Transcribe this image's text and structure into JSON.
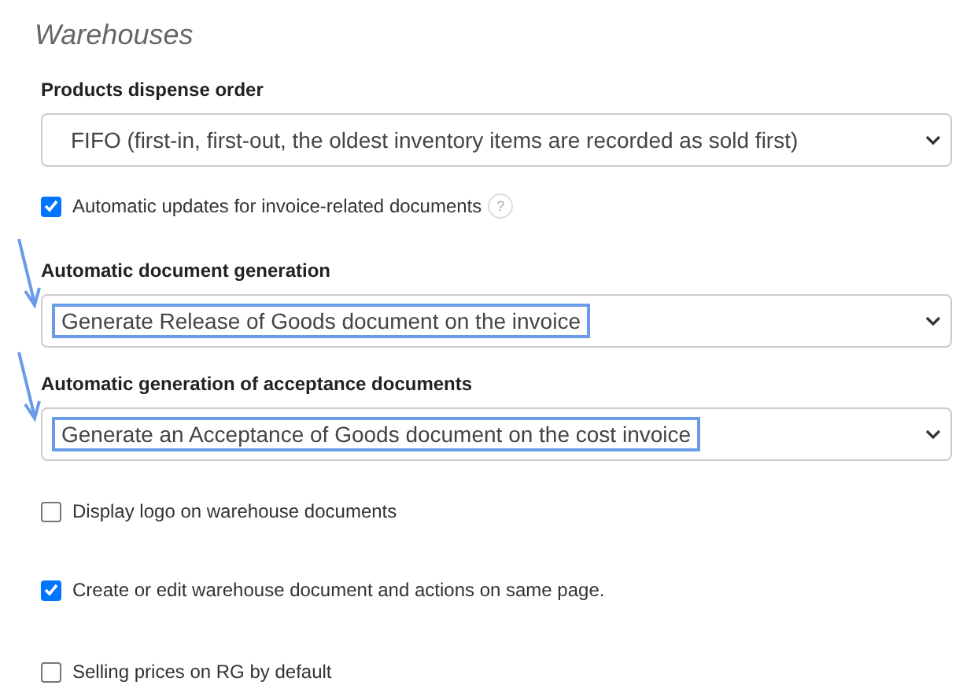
{
  "title": "Warehouses",
  "settings": [
    {
      "kind": "select",
      "label": "Products dispense order",
      "value": "FIFO (first-in, first-out, the oldest inventory items are recorded as sold first)",
      "highlighted": false
    },
    {
      "kind": "checkbox",
      "label": "Automatic updates for invoice-related documents",
      "checked": true,
      "help": "?"
    },
    {
      "kind": "select",
      "label": "Automatic document generation",
      "value": "Generate Release of Goods document on the invoice",
      "highlighted": true
    },
    {
      "kind": "select",
      "label": "Automatic generation of acceptance documents",
      "value": "Generate an Acceptance of Goods document on the cost invoice",
      "highlighted": true
    },
    {
      "kind": "checkbox",
      "label": "Display logo on warehouse documents",
      "checked": false
    },
    {
      "kind": "checkbox",
      "label": "Create or edit warehouse document and actions on same page.",
      "checked": true
    },
    {
      "kind": "checkbox",
      "label": "Selling prices on RG by default",
      "checked": false
    }
  ]
}
